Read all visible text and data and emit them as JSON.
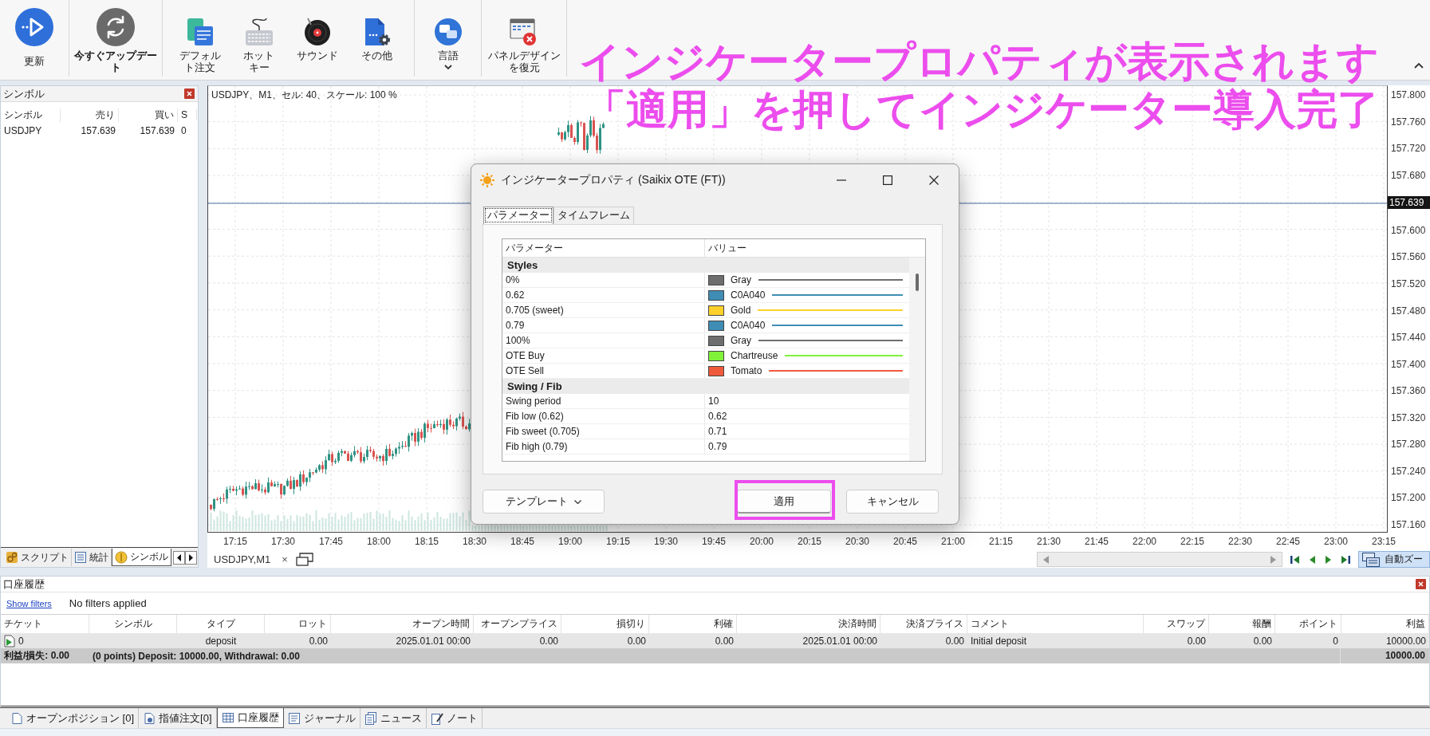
{
  "toolbar": {
    "buttons": [
      {
        "label": "更新",
        "dropdown": false
      },
      {
        "label": "今すぐアップデート",
        "dropdown": false
      },
      {
        "label": "デフォルト注文",
        "dropdown": false
      },
      {
        "label": "ホットキー",
        "dropdown": false
      },
      {
        "label": "サウンド",
        "dropdown": false
      },
      {
        "label": "その他",
        "dropdown": false
      },
      {
        "label": "言語",
        "dropdown": true
      },
      {
        "label": "パネルデザインを復元",
        "dropdown": false
      }
    ]
  },
  "annotation": [
    "インジケータープロパティが表示されます",
    "「適用」を押してインジケーター導入完了"
  ],
  "symbol_panel": {
    "title": "シンボル",
    "columns": [
      "シンボル",
      "売り",
      "買い",
      "S"
    ],
    "rows": [
      [
        "USDJPY",
        "157.639",
        "157.639",
        "0"
      ]
    ],
    "tabs": [
      {
        "label": "スクリプト",
        "selected": false
      },
      {
        "label": "統計",
        "selected": false
      },
      {
        "label": "シンボル",
        "selected": true
      }
    ]
  },
  "chart": {
    "info": "USDJPY、M1、セル: 40、スケール: 100 %",
    "price_axis": [
      {
        "kind": "tick",
        "label": "157.800"
      },
      {
        "kind": "tick",
        "label": "157.760"
      },
      {
        "kind": "tick",
        "label": "157.720"
      },
      {
        "kind": "tick",
        "label": "157.680"
      },
      {
        "kind": "current",
        "label": "157.639"
      },
      {
        "kind": "tick",
        "label": "157.600"
      },
      {
        "kind": "tick",
        "label": "157.560"
      },
      {
        "kind": "tick",
        "label": "157.520"
      },
      {
        "kind": "tick",
        "label": "157.480"
      },
      {
        "kind": "tick",
        "label": "157.440"
      },
      {
        "kind": "tick",
        "label": "157.400"
      },
      {
        "kind": "tick",
        "label": "157.360"
      },
      {
        "kind": "tick",
        "label": "157.320"
      },
      {
        "kind": "tick",
        "label": "157.280"
      },
      {
        "kind": "tick",
        "label": "157.240"
      },
      {
        "kind": "tick",
        "label": "157.200"
      },
      {
        "kind": "tick",
        "label": "157.160"
      }
    ],
    "time_axis": [
      "17:15",
      "17:30",
      "17:45",
      "18:00",
      "18:15",
      "18:30",
      "18:45",
      "19:00",
      "19:15",
      "19:30",
      "19:45",
      "20:00",
      "20:15",
      "20:30",
      "20:45",
      "21:00",
      "21:15",
      "21:30",
      "21:45",
      "22:00",
      "22:15",
      "22:30",
      "22:45",
      "23:00",
      "23:15"
    ],
    "tab": {
      "label": "USDJPY,M1",
      "close": "×"
    },
    "auto_zoom": {
      "label": "自動ズー",
      "on": true
    }
  },
  "dialog": {
    "title": "インジケータープロパティ (Saikix OTE (FT))",
    "tabs": [
      {
        "label": "パラメーター",
        "selected": true
      },
      {
        "label": "タイムフレーム",
        "selected": false
      }
    ],
    "columns": [
      "パラメーター",
      "バリュー"
    ],
    "rows": [
      {
        "kind": "group",
        "name": "Styles"
      },
      {
        "kind": "color",
        "name": "0%",
        "value": "Gray",
        "color": "#6e6e6e"
      },
      {
        "kind": "color",
        "name": "0.62",
        "value": "C0A040",
        "color": "#3f8db5"
      },
      {
        "kind": "color",
        "name": "0.705 (sweet)",
        "value": "Gold",
        "color": "#fdd12a"
      },
      {
        "kind": "color",
        "name": "0.79",
        "value": "C0A040",
        "color": "#3f8db5"
      },
      {
        "kind": "color",
        "name": "100%",
        "value": "Gray",
        "color": "#6e6e6e"
      },
      {
        "kind": "color",
        "name": "OTE Buy",
        "value": "Chartreuse",
        "color": "#80f23a"
      },
      {
        "kind": "color",
        "name": "OTE Sell",
        "value": "Tomato",
        "color": "#f05a3c"
      },
      {
        "kind": "group",
        "name": "Swing / Fib"
      },
      {
        "kind": "text",
        "name": "Swing period",
        "value": "10"
      },
      {
        "kind": "text",
        "name": "Fib low (0.62)",
        "value": "0.62"
      },
      {
        "kind": "text",
        "name": "Fib sweet (0.705)",
        "value": "0.71"
      },
      {
        "kind": "text",
        "name": "Fib high (0.79)",
        "value": "0.79"
      }
    ],
    "buttons": [
      {
        "label": "テンプレート",
        "dropdown": true,
        "highlighted": false
      },
      {
        "label": "適用",
        "dropdown": false,
        "highlighted": true
      },
      {
        "label": "キャンセル",
        "dropdown": false,
        "highlighted": false
      }
    ]
  },
  "history_panel": {
    "title": "口座履歴",
    "filter_link": "Show filters",
    "filter_status": "No filters applied",
    "columns": [
      "チケット",
      "シンボル",
      "タイプ",
      "ロット",
      "オープン時間",
      "オープンプライス",
      "損切り",
      "利確",
      "決済時間",
      "決済プライス",
      "コメント",
      "スワップ",
      "報酬",
      "ポイント",
      "利益"
    ],
    "rows": [
      {
        "ticket": "0",
        "type": "deposit",
        "lots": "0.00",
        "open_time": "2025.01.01 00:00",
        "open_price": "0.00",
        "stop_loss": "0.00",
        "take_profit": "0.00",
        "close_time": "2025.01.01 00:00",
        "close_price": "0.00",
        "comment": "Initial deposit",
        "swap": "0.00",
        "commission": "0.00",
        "points": "0",
        "profit": "10000.00"
      }
    ],
    "summary": {
      "label": "利益/損失: 0.00",
      "detail": "(0 points) Deposit: 10000.00, Withdrawal: 0.00",
      "total": "10000.00"
    }
  },
  "bottom_tabs": [
    {
      "label": "オープンポジション [0]",
      "selected": false
    },
    {
      "label": "指値注文[0]",
      "selected": false
    },
    {
      "label": "口座履歴",
      "selected": true
    },
    {
      "label": "ジャーナル",
      "selected": false
    },
    {
      "label": "ニュース",
      "selected": false
    },
    {
      "label": "ノート",
      "selected": false
    }
  ]
}
